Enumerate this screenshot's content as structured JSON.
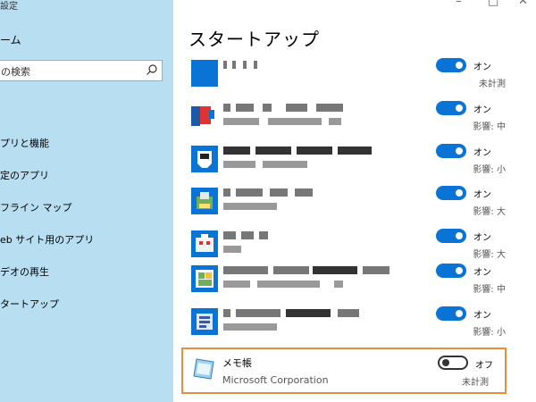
{
  "window": {
    "title": "設定"
  },
  "sidebar": {
    "home": "ーム",
    "search_placeholder": "の検索",
    "items": [
      {
        "label": "プリと機能"
      },
      {
        "label": "定のアプリ"
      },
      {
        "label": "フライン マップ"
      },
      {
        "label": "eb サイト用のアプリ"
      },
      {
        "label": "デオの再生"
      },
      {
        "label": "タートアップ"
      }
    ]
  },
  "main": {
    "title": "スタートアップ",
    "apps": [
      {
        "state": "オン",
        "impact": "未計測"
      },
      {
        "state": "オン",
        "impact": "影響: 中"
      },
      {
        "state": "オン",
        "impact": "影響: 小"
      },
      {
        "state": "オン",
        "impact": "影響: 大"
      },
      {
        "state": "オン",
        "impact": "影響: 大"
      },
      {
        "state": "オン",
        "impact": "影響: 中"
      },
      {
        "state": "オン",
        "impact": "影響: 小"
      }
    ],
    "notepad": {
      "name": "メモ帳",
      "publisher": "Microsoft Corporation",
      "state": "オフ",
      "impact": "未計測"
    }
  },
  "colors": {
    "sidebar_bg": "#b8def2",
    "toggle_on": "#0a74d6",
    "highlight": "#ef8c3a"
  }
}
